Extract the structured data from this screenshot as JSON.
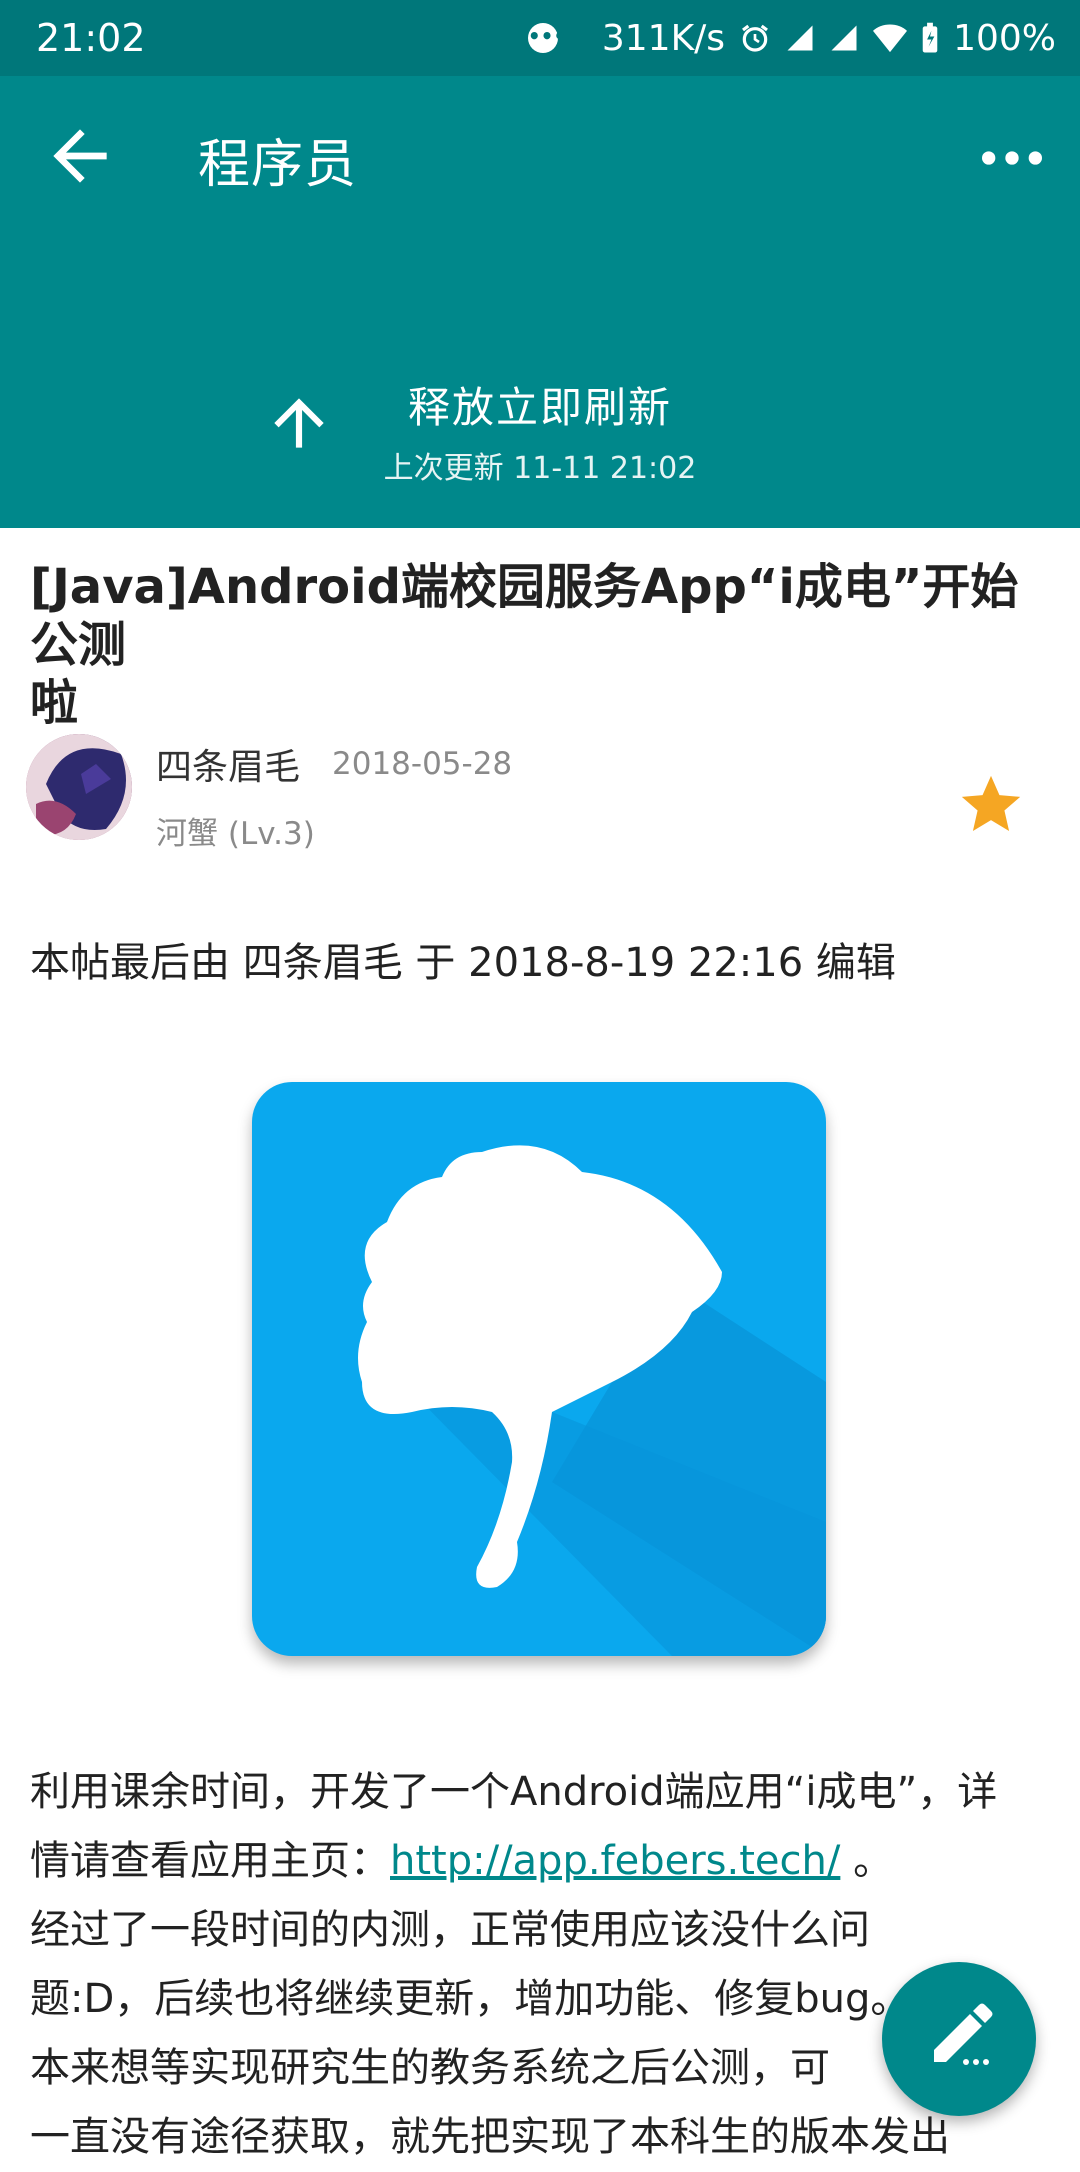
{
  "status_bar": {
    "time": "21:02",
    "speed": "311K/s",
    "battery": "100%",
    "icons": [
      "chat-icon",
      "alarm-icon",
      "signal-icon",
      "signal-icon",
      "wifi-icon",
      "battery-icon"
    ]
  },
  "app_bar": {
    "title": "程序员",
    "refresh_label": "释放立即刷新",
    "last_updated": "上次更新 11-11 21:02",
    "color": "#00888b"
  },
  "post": {
    "title_line1": "[Java]Android端校园服务App“i成电”开始公测",
    "title_line2": "啦",
    "author": "四条眉毛",
    "date": "2018-05-28",
    "level": "河蟹 (Lv.3)",
    "edit_note": "本帖最后由 四条眉毛 于 2018-8-19 22:16 编辑",
    "body": {
      "line1": "利用课余时间，开发了一个Android端应用“i成电”，详",
      "line2_prefix": "情请查看应用主页：",
      "link": "http://app.febers.tech/",
      "line2_suffix": " 。",
      "line3": "经过了一段时间的内测，正常使用应该没什么问",
      "line4": "题:D，后续也将继续更新，增加功能、修复bug。",
      "line5": "本来想等实现研究生的教务系统之后公测，可",
      "line6": "一直没有途径获取，就先把实现了本科生的版本发出"
    }
  },
  "colors": {
    "star": "#f5a623",
    "app_icon_bg": "#0aa8ee",
    "link": "#00888b"
  }
}
